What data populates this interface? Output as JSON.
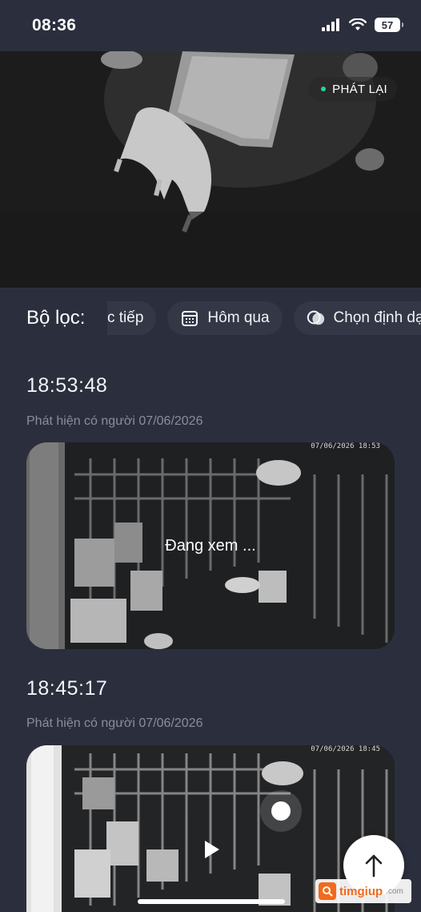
{
  "status_bar": {
    "time": "08:36",
    "battery": "57",
    "icons": [
      "cellular-signal-icon",
      "wifi-icon",
      "battery-icon"
    ]
  },
  "live_view": {
    "playback_label": "PHÁT LẠI"
  },
  "filter": {
    "label": "Bộ lọc:",
    "chips": [
      {
        "label": "c tiếp",
        "icon": ""
      },
      {
        "label": "Hôm qua",
        "icon": "calendar-icon"
      },
      {
        "label": "Chọn định dạ",
        "icon": "format-icon"
      }
    ]
  },
  "events": [
    {
      "time": "18:53:48",
      "description": "Phát hiện có người 07/06/2026",
      "overlay": "Đang xem ...",
      "stamp": "07/06/2026 18:53"
    },
    {
      "time": "18:45:17",
      "description": "Phát hiện có người 07/06/2026",
      "overlay": "",
      "stamp": "07/06/2026 18:45"
    }
  ],
  "watermark": {
    "brand": "timgiup",
    "tld": ".com"
  },
  "colors": {
    "background": "#2b2f3d",
    "chip": "#343846",
    "accent_dot": "#28d39a",
    "muted_text": "#8a8e9c",
    "watermark": "#f26a1b"
  }
}
